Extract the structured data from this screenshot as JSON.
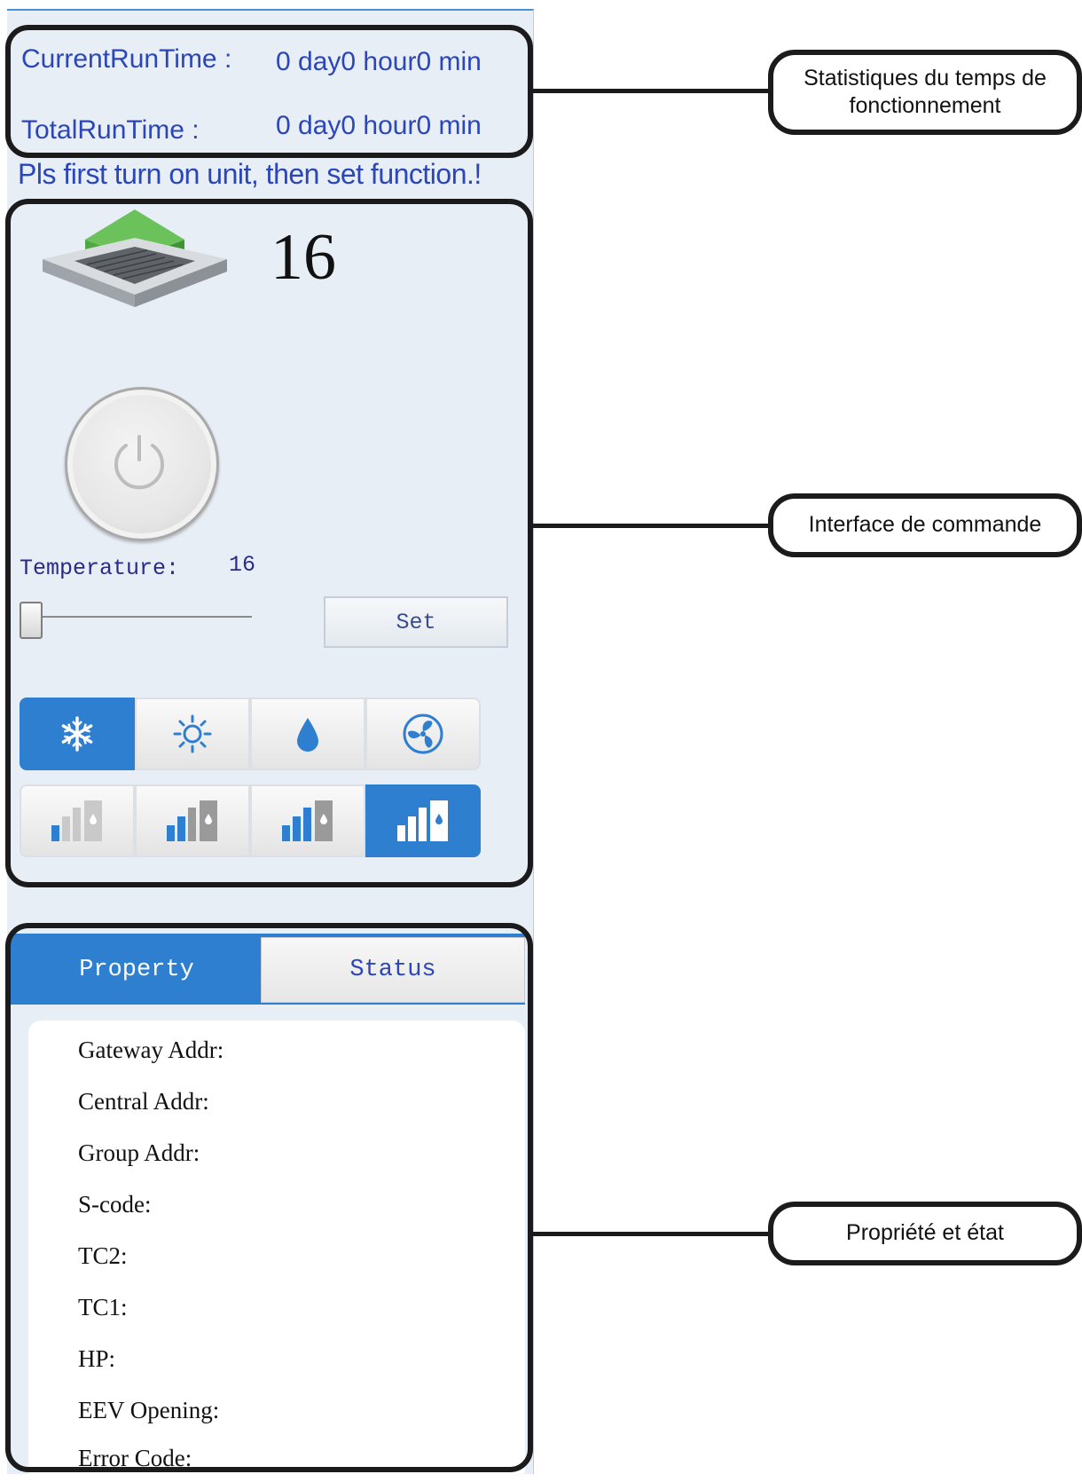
{
  "runtime": {
    "current_label": "CurrentRunTime :",
    "current_value": "0 day0 hour0 min",
    "total_label": "TotalRunTime :",
    "total_value": "0 day0 hour0 min"
  },
  "notice": "Pls first turn on unit, then set function.!",
  "control": {
    "display_temperature": "16",
    "temperature_label": "Temperature:",
    "temperature_value": "16",
    "set_label": "Set",
    "modes": [
      {
        "name": "snowflake-icon",
        "active": true
      },
      {
        "name": "sun-icon",
        "active": false
      },
      {
        "name": "water-drop-icon",
        "active": false
      },
      {
        "name": "fan-icon",
        "active": false
      }
    ],
    "fan_speeds": [
      {
        "name": "fan-speed-1-icon",
        "active": false
      },
      {
        "name": "fan-speed-2-icon",
        "active": false
      },
      {
        "name": "fan-speed-3-icon",
        "active": false
      },
      {
        "name": "fan-speed-4-icon",
        "active": true
      }
    ],
    "accent_color": "#2f7fd0"
  },
  "tabs": {
    "property": "Property",
    "status": "Status"
  },
  "properties": [
    "Gateway Addr:",
    "Central Addr:",
    "Group Addr:",
    "S-code:",
    "TC2:",
    "TC1:",
    "HP:",
    "EEV Opening:",
    "Error Code:"
  ],
  "callouts": {
    "runtime": "Statistiques du temps de fonctionnement",
    "control": "Interface de commande",
    "property": "Propriété et état"
  }
}
